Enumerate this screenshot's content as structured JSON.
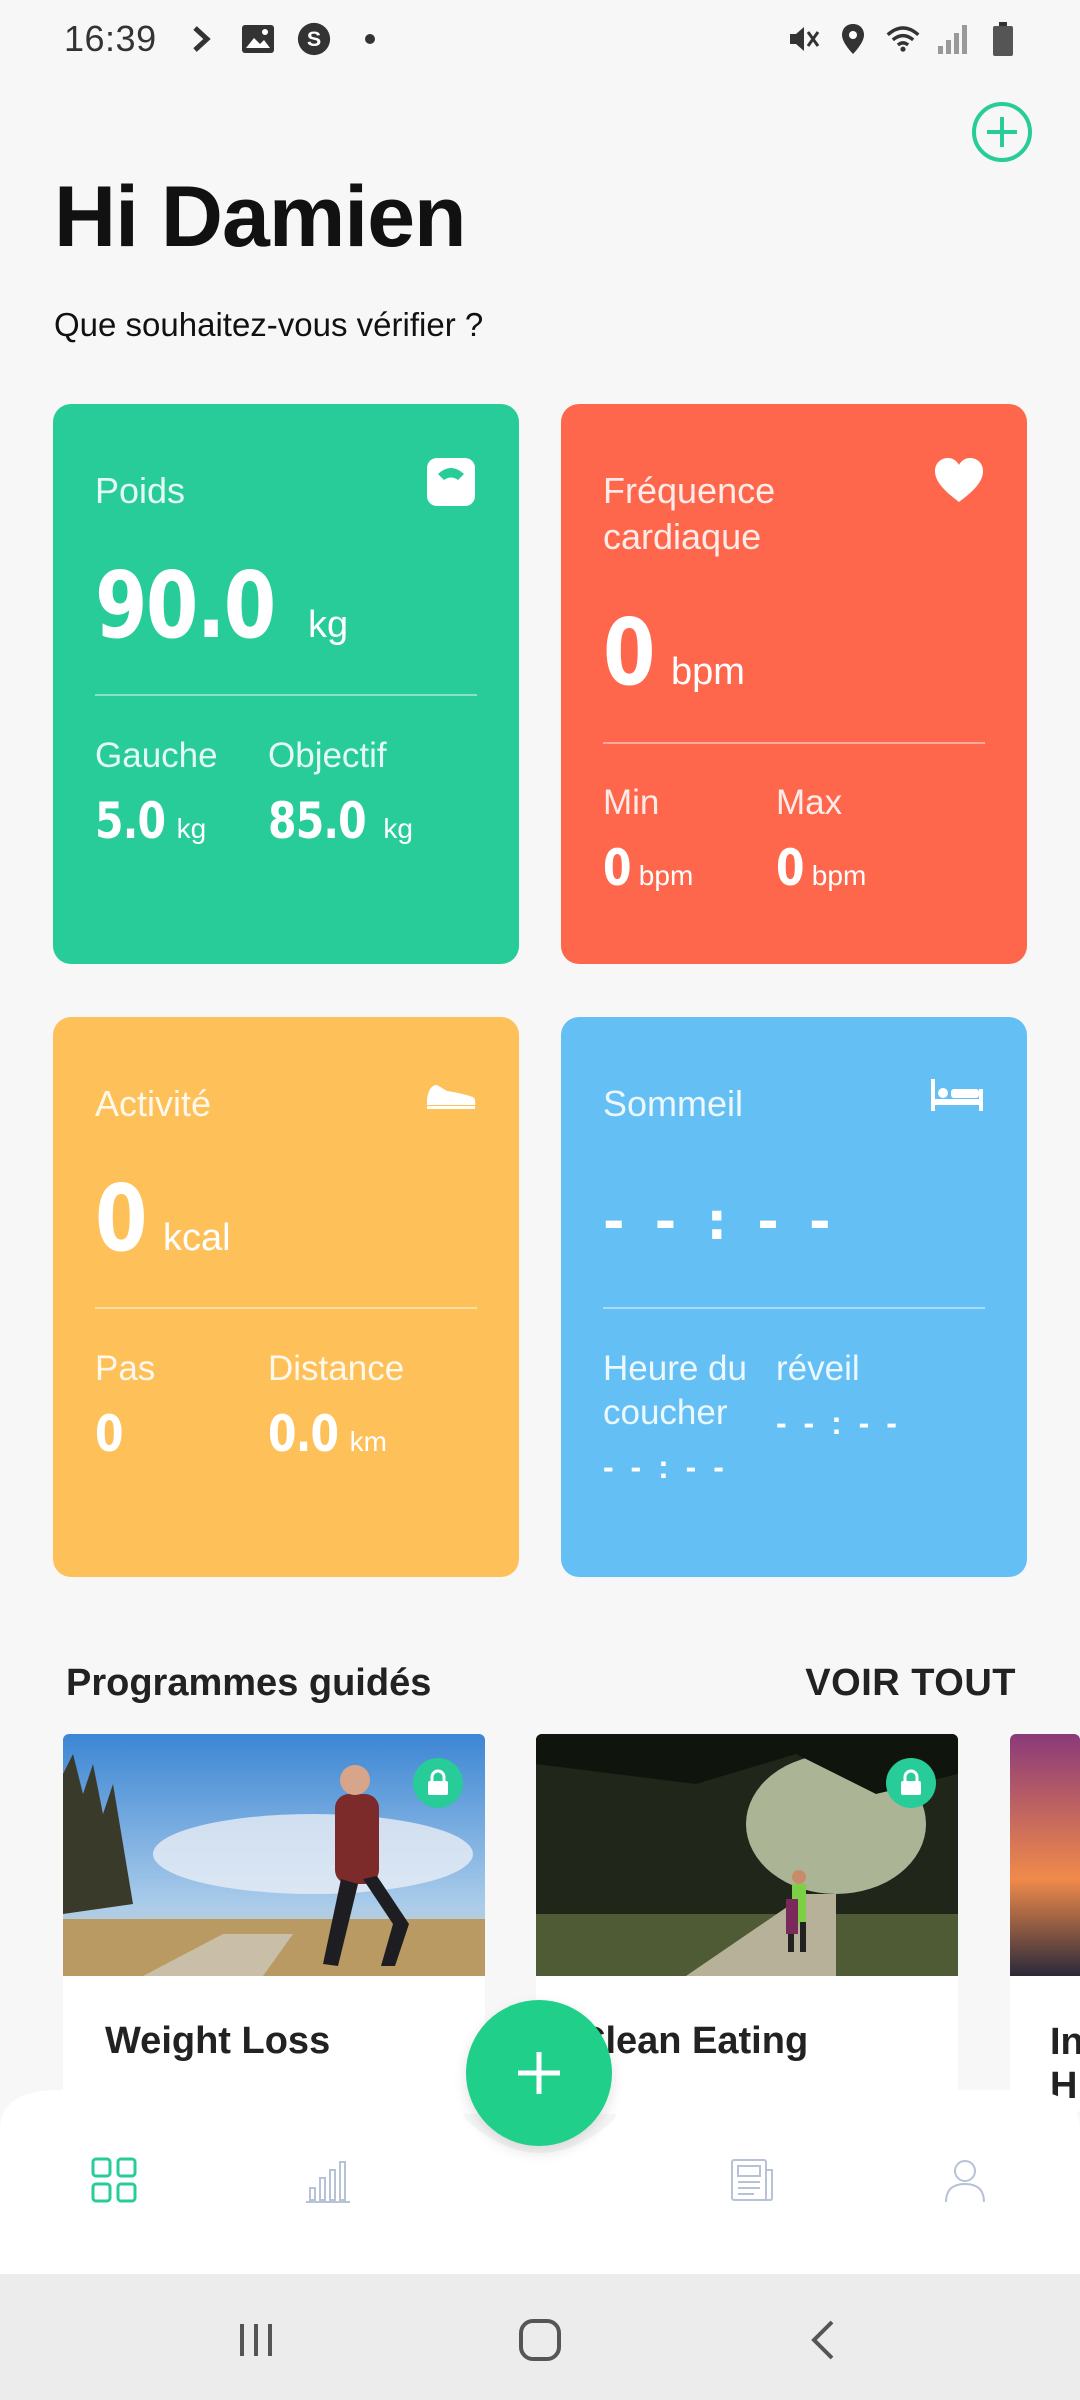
{
  "status_bar": {
    "time": "16:39",
    "left_icons": [
      "arrow-icon",
      "image-icon",
      "s-app-icon",
      "dot-icon"
    ],
    "right_icons": [
      "mute-icon",
      "location-icon",
      "wifi-icon",
      "signal-icon",
      "battery-icon"
    ]
  },
  "header": {
    "greeting": "Hi Damien",
    "subtitle": "Que souhaitez-vous vérifier ?",
    "add_icon": "plus-circle-icon"
  },
  "cards": {
    "weight": {
      "title": "Poids",
      "value": "90.0",
      "unit": "kg",
      "left_label": "Gauche",
      "left_value": "5.0",
      "left_unit": "kg",
      "goal_label": "Objectif",
      "goal_value": "85.0",
      "goal_unit": "kg",
      "color": "#27cc98",
      "icon": "scale-icon"
    },
    "heart": {
      "title": "Fréquence cardiaque",
      "value": "0",
      "unit": "bpm",
      "min_label": "Min",
      "min_value": "0",
      "min_unit": "bpm",
      "max_label": "Max",
      "max_value": "0",
      "max_unit": "bpm",
      "color": "#fe674c",
      "icon": "heart-icon"
    },
    "activity": {
      "title": "Activité",
      "value": "0",
      "unit": "kcal",
      "steps_label": "Pas",
      "steps_value": "0",
      "distance_label": "Distance",
      "distance_value": "0.0",
      "distance_unit": "km",
      "color": "#fec15a",
      "icon": "shoe-icon"
    },
    "sleep": {
      "title": "Sommeil",
      "value": "- - : - -",
      "bedtime_label": "Heure du coucher",
      "bedtime_value": "- - : - -",
      "wake_label": "réveil",
      "wake_value": "- - : - -",
      "color": "#64c0f4",
      "icon": "bed-icon"
    }
  },
  "programs": {
    "title": "Programmes guidés",
    "see_all": "VOIR TOUT",
    "items": [
      {
        "label": "Weight Loss",
        "locked": true
      },
      {
        "label": "Clean Eating",
        "locked": true
      },
      {
        "label": "In H",
        "locked": true
      }
    ]
  },
  "bottom_nav": {
    "items": [
      "dashboard-icon",
      "stats-icon",
      "articles-icon",
      "profile-icon"
    ],
    "fab_icon": "plus-icon",
    "accent": "#27cc98"
  },
  "system_nav": [
    "recents-icon",
    "home-icon",
    "back-icon"
  ]
}
